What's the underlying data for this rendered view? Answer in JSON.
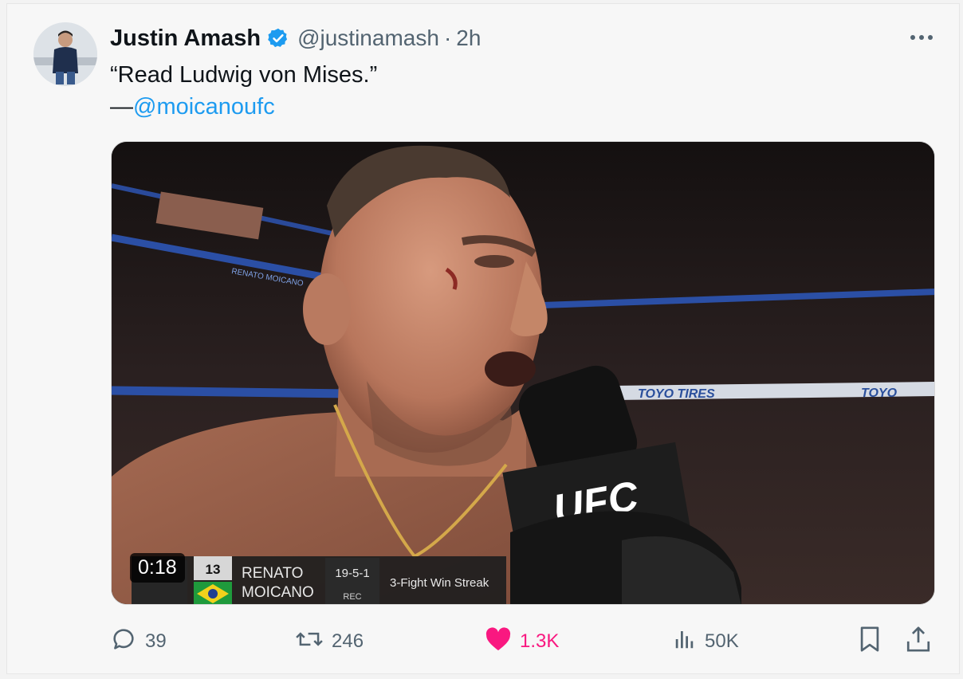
{
  "tweet": {
    "author_name": "Justin Amash",
    "handle": "@justinamash",
    "separator": "·",
    "time": "2h",
    "text_line1": "“Read Ludwig von Mises.”",
    "text_dash": "—",
    "text_mention": "@moicanoufc"
  },
  "media": {
    "duration": "0:18",
    "overlay": {
      "rank": "13",
      "first_name": "RENATO",
      "last_name": "MOICANO",
      "record": "19-5-1",
      "record_label": "REC",
      "streak": "3-Fight Win Streak",
      "banner_left": "RENATO MOICANO",
      "banner_sponsor": "TOYO TIRES",
      "banner_sponsor_partial": "TOYO",
      "mic_brand": "UFC"
    }
  },
  "actions": {
    "replies": "39",
    "reposts": "246",
    "likes": "1.3K",
    "views": "50K"
  },
  "colors": {
    "verified": "#1d9bf0",
    "mention": "#1d9bf0",
    "like": "#f91880",
    "muted": "#536471"
  },
  "icons": [
    "reply-icon",
    "repost-icon",
    "heart-icon",
    "views-icon",
    "bookmark-icon",
    "share-icon",
    "more-icon",
    "verified-badge-icon"
  ]
}
